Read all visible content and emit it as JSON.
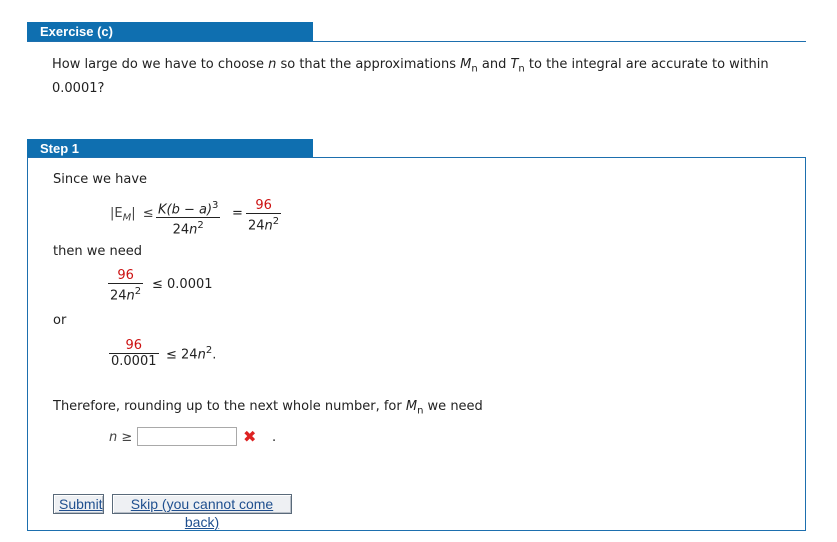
{
  "exercise": {
    "header": "Exercise (c)",
    "question_part1": "How large do we have to choose ",
    "var_n": "n",
    "question_part2": " so that the approximations ",
    "M": "M",
    "sub_n": "n",
    "and_word": " and ",
    "T": "T",
    "question_part3": " to the integral are accurate to within",
    "question_line2": "0.0001?"
  },
  "step": {
    "header": "Step 1",
    "since_text": "Since we have",
    "abs_em": "|E",
    "abs_em_sub": "M",
    "abs_close": "|",
    "leq": "≤",
    "eq": "=",
    "k_num": "K(b − a)",
    "k_num_exp": "3",
    "den_24": "24",
    "den_n": "n",
    "den_exp": "2",
    "red_value": "96",
    "then_text": "then we need",
    "leq_value": "≤ 0.0001",
    "or_text": "or",
    "den_small": "0.0001",
    "rhs_24": "≤ 24",
    "rhs_n": "n",
    "rhs_exp": "2",
    "rhs_period": ".",
    "therefore_text": "Therefore, rounding up to the next whole number, for ",
    "therefore_M": "M",
    "therefore_sub": "n",
    "therefore_end": " we need",
    "n_geq_n": "n",
    "n_geq_sym": " ≥",
    "answer_value": "",
    "wrong_mark": "✖",
    "trailing_period": "."
  },
  "buttons": {
    "submit": "Submit",
    "skip": "Skip (you cannot come back)"
  },
  "colors": {
    "header_bg": "#0f6fb0",
    "wrong": "#dd2222"
  }
}
